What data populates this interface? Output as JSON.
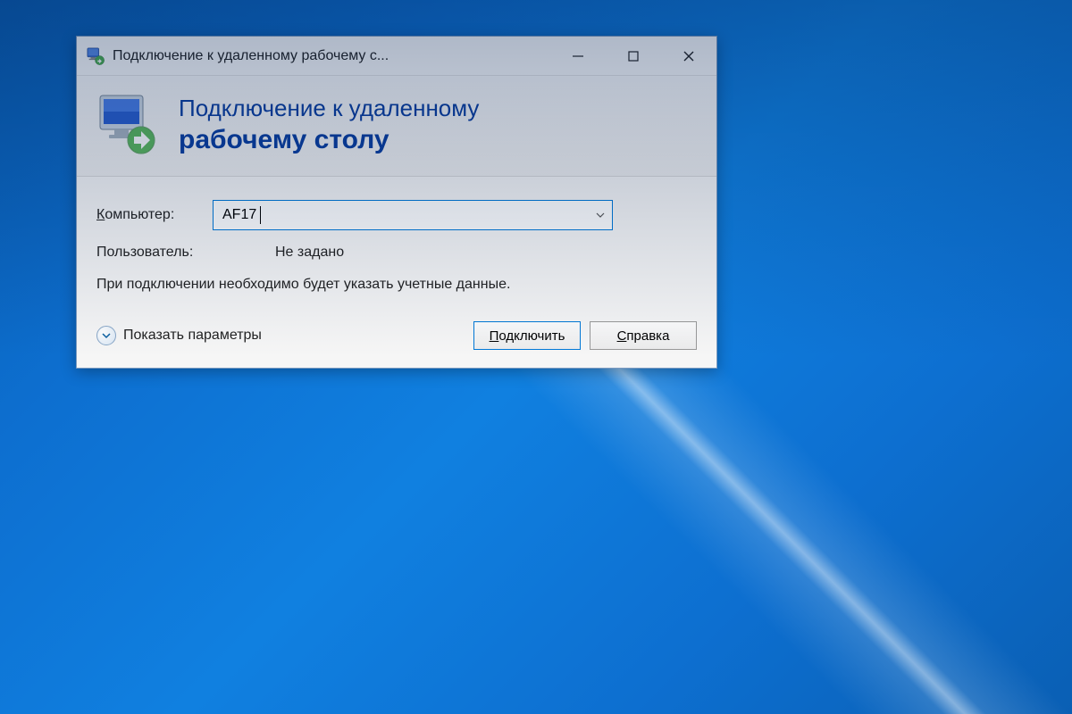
{
  "window": {
    "title": "Подключение к удаленному рабочему с..."
  },
  "banner": {
    "line1": "Подключение к удаленному",
    "line2": "рабочему столу"
  },
  "form": {
    "computer_label_prefix": "К",
    "computer_label_rest": "омпьютер:",
    "computer_value": "AF17",
    "user_label": "Пользователь:",
    "user_value": "Не задано",
    "hint": "При подключении необходимо будет указать учетные данные."
  },
  "footer": {
    "show_params": "Показать параметры",
    "connect_prefix": "П",
    "connect_rest": "одключить",
    "help_prefix": "С",
    "help_rest": "правка"
  }
}
